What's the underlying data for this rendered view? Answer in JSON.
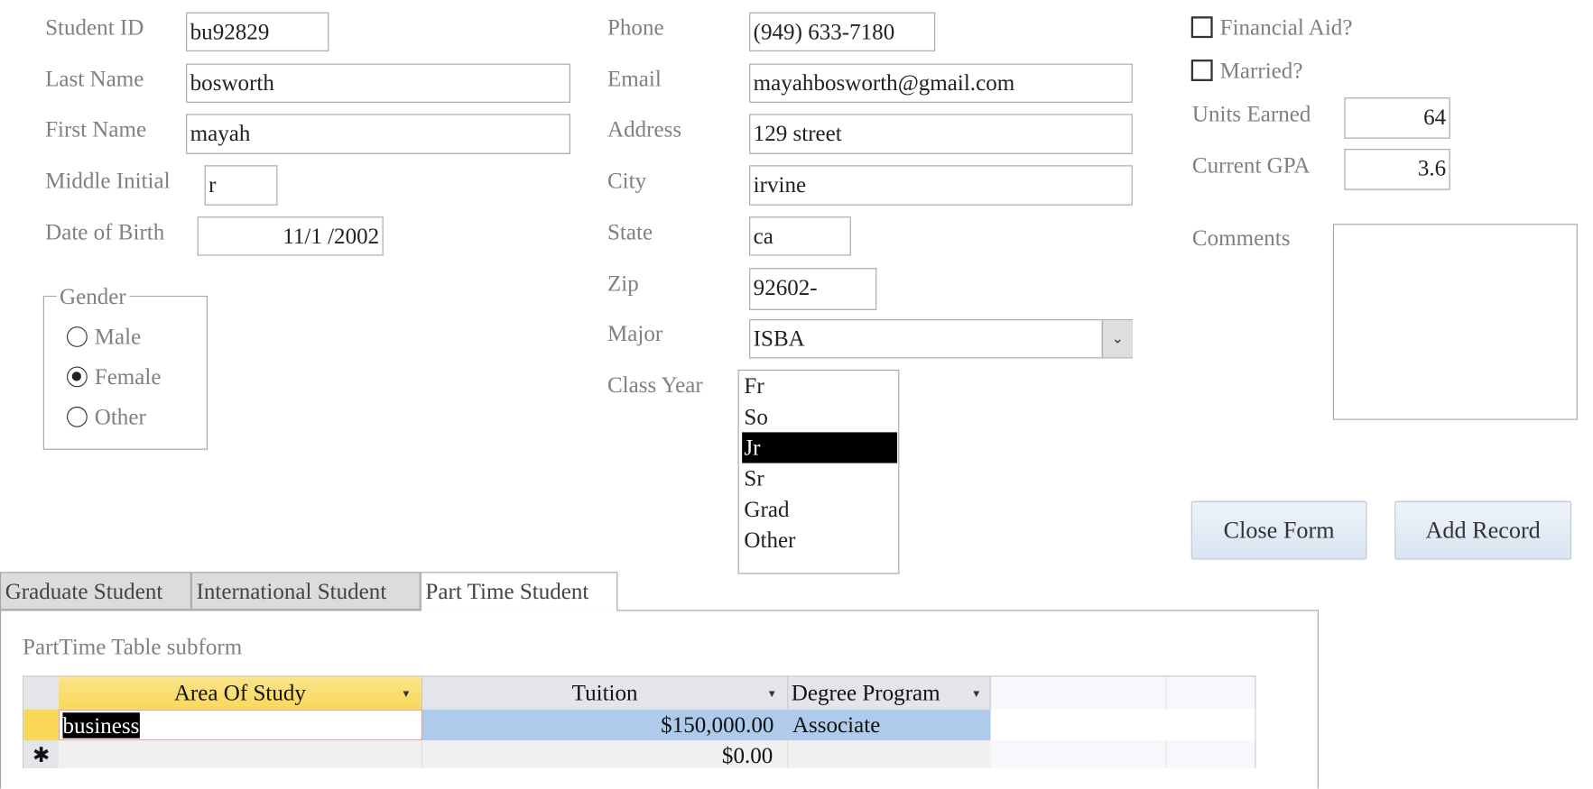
{
  "student": {
    "student_id": {
      "label": "Student ID",
      "value": "bu92829"
    },
    "last_name": {
      "label": "Last Name",
      "value": "bosworth"
    },
    "first_name": {
      "label": "First Name",
      "value": "mayah"
    },
    "middle_initial": {
      "label": "Middle Initial",
      "value": "r"
    },
    "dob": {
      "label": "Date of Birth",
      "value": "11/1 /2002"
    },
    "gender": {
      "legend": "Gender",
      "options": [
        "Male",
        "Female",
        "Other"
      ],
      "selected": "Female"
    }
  },
  "contact": {
    "phone": {
      "label": "Phone",
      "value": "(949) 633-7180"
    },
    "email": {
      "label": "Email",
      "value": "mayahbosworth@gmail.com"
    },
    "address": {
      "label": "Address",
      "value": "129 street"
    },
    "city": {
      "label": "City",
      "value": "irvine"
    },
    "state": {
      "label": "State",
      "value": "ca"
    },
    "zip": {
      "label": "Zip",
      "value": "92602-"
    },
    "major": {
      "label": "Major",
      "value": "ISBA"
    },
    "class_year": {
      "label": "Class Year",
      "options": [
        "Fr",
        "So",
        "Jr",
        "Sr",
        "Grad",
        "Other"
      ],
      "selected": "Jr"
    }
  },
  "status": {
    "financial_aid": {
      "label": "Financial Aid?",
      "checked": false
    },
    "married": {
      "label": "Married?",
      "checked": false
    },
    "units_earned": {
      "label": "Units Earned",
      "value": "64"
    },
    "gpa": {
      "label": "Current GPA",
      "value": "3.6"
    },
    "comments": {
      "label": "Comments",
      "value": ""
    }
  },
  "buttons": {
    "close": "Close Form",
    "add": "Add Record"
  },
  "tabs": [
    {
      "label": "Graduate Student"
    },
    {
      "label": "International Student"
    },
    {
      "label": "Part Time Student",
      "active": true
    }
  ],
  "subform": {
    "title": "PartTime Table subform",
    "columns": [
      "Area Of Study",
      "Tuition",
      "Degree Program"
    ],
    "rows": [
      [
        "business",
        "$150,000.00",
        "Associate"
      ]
    ],
    "new_row": {
      "marker": "✱",
      "tuition": "$0.00"
    }
  }
}
